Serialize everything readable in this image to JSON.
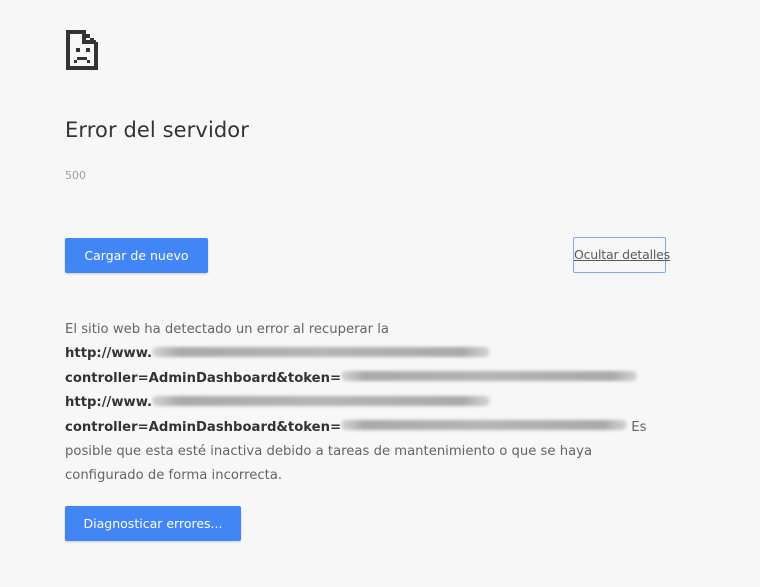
{
  "icon": "sad-file-icon",
  "title": "Error del servidor",
  "error_code": "500",
  "buttons": {
    "reload": "Cargar de nuevo",
    "details": "Ocultar detalles",
    "diagnose": "Diagnosticar errores..."
  },
  "details": {
    "intro": "El sitio web ha detectado un error al recuperar la",
    "url_prefix": "http://www.",
    "controller_text": "controller=AdminDashboard&token=",
    "inline_tail": " Es",
    "line_6": "posible que esta esté inactiva debido a tareas de mantenimiento o que se haya",
    "line_7": "configurado de forma incorrecta."
  },
  "colors": {
    "background": "#f7f7f7",
    "button_blue": "#4285f4",
    "title_text": "#333333",
    "body_text": "#646464"
  }
}
